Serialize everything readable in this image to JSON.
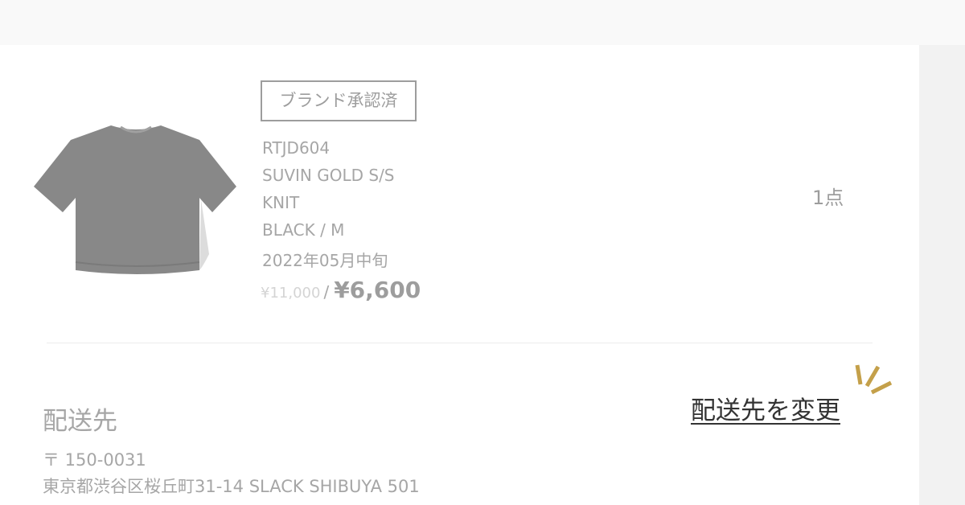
{
  "product": {
    "badge": "ブランド承認済",
    "code": "RTJD604",
    "name_line1": "SUVIN GOLD S/S",
    "name_line2": "KNIT",
    "variant": "BLACK / M",
    "delivery": "2022年05月中旬",
    "original_price": "¥11,000",
    "price_separator": "/",
    "sale_price": "¥6,600",
    "quantity": "1点",
    "image_icon": "knit-tshirt-image"
  },
  "shipping": {
    "title": "配送先",
    "zip": "〒 150-0031",
    "address": "東京都渋谷区桜丘町31-14 SLACK SHIBUYA 501",
    "change_label": "配送先を変更"
  },
  "colors": {
    "background": "#f9f9f9",
    "card": "#ffffff",
    "muted_text": "#a6a6a6",
    "link_text": "#333333",
    "accent_gold": "#c4a04a"
  }
}
